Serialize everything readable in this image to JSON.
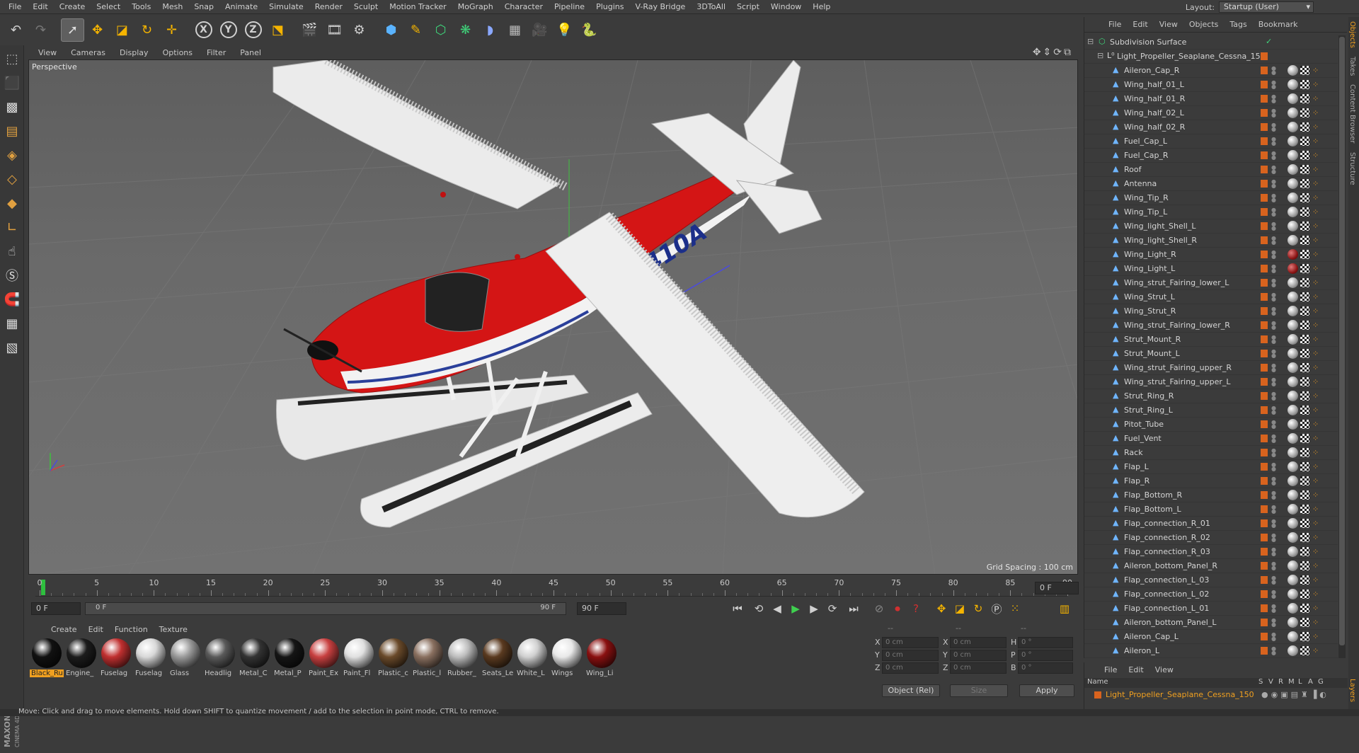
{
  "menubar": {
    "items": [
      "File",
      "Edit",
      "Create",
      "Select",
      "Tools",
      "Mesh",
      "Snap",
      "Animate",
      "Simulate",
      "Render",
      "Sculpt",
      "Motion Tracker",
      "MoGraph",
      "Character",
      "Pipeline",
      "Plugins",
      "V-Ray Bridge",
      "3DToAll",
      "Script",
      "Window",
      "Help"
    ],
    "layout_label": "Layout:",
    "layout_value": "Startup (User)"
  },
  "viewport": {
    "menu": [
      "View",
      "Cameras",
      "Display",
      "Options",
      "Filter",
      "Panel"
    ],
    "label": "Perspective",
    "grid_spacing": "Grid Spacing : 100 cm",
    "registration": "N1410A"
  },
  "timeline": {
    "ticks": [
      "0",
      "5",
      "10",
      "15",
      "20",
      "25",
      "30",
      "35",
      "40",
      "45",
      "50",
      "55",
      "60",
      "65",
      "70",
      "75",
      "80",
      "85",
      "90"
    ],
    "current_frame_display": "0 F",
    "start_field": "0 F",
    "slider_start": "0 F",
    "slider_end": "90 F",
    "end_field": "90 F"
  },
  "materials": {
    "menu": [
      "Create",
      "Edit",
      "Function",
      "Texture"
    ],
    "items": [
      {
        "name": "Black_Ru",
        "color": "#111111",
        "selected": true
      },
      {
        "name": "Engine_",
        "color": "#1c1c1c"
      },
      {
        "name": "Fuselag",
        "color": "#c03030"
      },
      {
        "name": "Fuselag",
        "color": "#d8d8d8"
      },
      {
        "name": "Glass",
        "color": "#9a9a9a"
      },
      {
        "name": "Headlig",
        "color": "#5a5a5a"
      },
      {
        "name": "Metal_C",
        "color": "#333333"
      },
      {
        "name": "Metal_P",
        "color": "#151515"
      },
      {
        "name": "Paint_Ex",
        "color": "#c84040"
      },
      {
        "name": "Paint_Fl",
        "color": "#e0e0e0"
      },
      {
        "name": "Plastic_c",
        "color": "#6a4a2a"
      },
      {
        "name": "Plastic_l",
        "color": "#8a7060"
      },
      {
        "name": "Rubber_",
        "color": "#bdbdbd"
      },
      {
        "name": "Seats_Le",
        "color": "#5a3a20"
      },
      {
        "name": "White_L",
        "color": "#d0d0d0"
      },
      {
        "name": "Wings",
        "color": "#e8e8e8"
      },
      {
        "name": "Wing_Li",
        "color": "#8a1010"
      }
    ]
  },
  "coordinates": {
    "headers": [
      "--",
      "--",
      "--"
    ],
    "rows": [
      {
        "a": "X",
        "v1": "0 cm",
        "b": "X",
        "v2": "0 cm",
        "c": "H",
        "v3": "0 °"
      },
      {
        "a": "Y",
        "v1": "0 cm",
        "b": "Y",
        "v2": "0 cm",
        "c": "P",
        "v3": "0 °"
      },
      {
        "a": "Z",
        "v1": "0 cm",
        "b": "Z",
        "v2": "0 cm",
        "c": "B",
        "v3": "0 °"
      }
    ],
    "mode": "Object (Rel)",
    "size": "Size",
    "apply": "Apply"
  },
  "object_manager": {
    "menu": [
      "File",
      "Edit",
      "View",
      "Objects",
      "Tags",
      "Bookmark"
    ],
    "root": "Subdivision Surface",
    "group": "Light_Propeller_Seaplane_Cessna_150",
    "objects": [
      {
        "name": "Aileron_Cap_R"
      },
      {
        "name": "Wing_half_01_L"
      },
      {
        "name": "Wing_half_01_R"
      },
      {
        "name": "Wing_half_02_L"
      },
      {
        "name": "Wing_half_02_R"
      },
      {
        "name": "Fuel_Cap_L"
      },
      {
        "name": "Fuel_Cap_R"
      },
      {
        "name": "Roof"
      },
      {
        "name": "Antenna"
      },
      {
        "name": "Wing_Tip_R"
      },
      {
        "name": "Wing_Tip_L"
      },
      {
        "name": "Wing_light_Shell_L"
      },
      {
        "name": "Wing_light_Shell_R"
      },
      {
        "name": "Wing_Light_R",
        "red": true
      },
      {
        "name": "Wing_Light_L",
        "red": true
      },
      {
        "name": "Wing_strut_Fairing_lower_L"
      },
      {
        "name": "Wing_Strut_L"
      },
      {
        "name": "Wing_Strut_R"
      },
      {
        "name": "Wing_strut_Fairing_lower_R"
      },
      {
        "name": "Strut_Mount_R"
      },
      {
        "name": "Strut_Mount_L"
      },
      {
        "name": "Wing_strut_Fairing_upper_R"
      },
      {
        "name": "Wing_strut_Fairing_upper_L"
      },
      {
        "name": "Strut_Ring_R"
      },
      {
        "name": "Strut_Ring_L"
      },
      {
        "name": "Pitot_Tube"
      },
      {
        "name": "Fuel_Vent"
      },
      {
        "name": "Rack"
      },
      {
        "name": "Flap_L"
      },
      {
        "name": "Flap_R"
      },
      {
        "name": "Flap_Bottom_R"
      },
      {
        "name": "Flap_Bottom_L"
      },
      {
        "name": "Flap_connection_R_01"
      },
      {
        "name": "Flap_connection_R_02"
      },
      {
        "name": "Flap_connection_R_03"
      },
      {
        "name": "Aileron_bottom_Panel_R"
      },
      {
        "name": "Flap_connection_L_03"
      },
      {
        "name": "Flap_connection_L_02"
      },
      {
        "name": "Flap_connection_L_01"
      },
      {
        "name": "Aileron_bottom_Panel_L"
      },
      {
        "name": "Aileron_Cap_L"
      },
      {
        "name": "Aileron_L"
      }
    ]
  },
  "side_tabs": [
    "Objects",
    "Takes",
    "Content Browser",
    "Structure"
  ],
  "layer_manager": {
    "menu": [
      "File",
      "Edit",
      "View"
    ],
    "columns": [
      "Name",
      "S",
      "V",
      "R",
      "M",
      "L",
      "A",
      "G"
    ],
    "row": "Light_Propeller_Seaplane_Cessna_150",
    "side_tab": "Layers"
  },
  "status": "Move: Click and drag to move elements. Hold down SHIFT to quantize movement / add to the selection in point mode, CTRL to remove."
}
